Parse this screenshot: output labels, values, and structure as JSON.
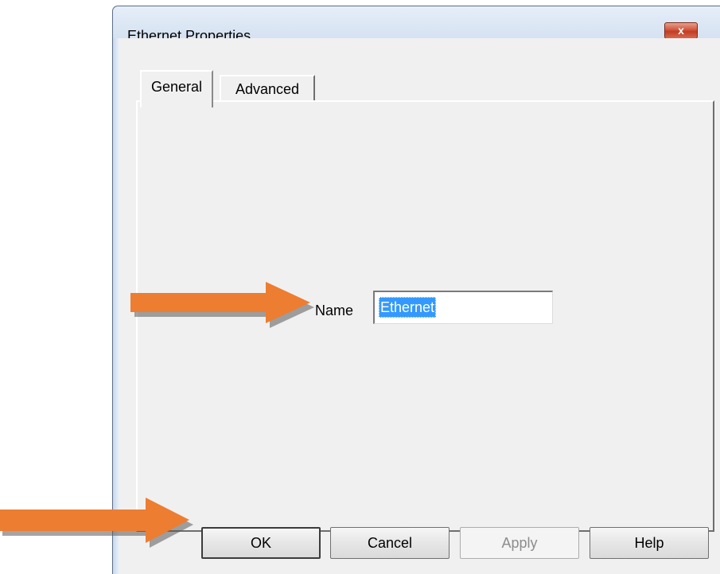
{
  "dialog": {
    "title": "Ethernet Properties",
    "close_symbol": "x"
  },
  "tabs": [
    {
      "label": "General",
      "selected": true
    },
    {
      "label": "Advanced",
      "selected": false
    }
  ],
  "general": {
    "name_label": "Name",
    "name_value": "Ethernet"
  },
  "buttons": {
    "ok": "OK",
    "cancel": "Cancel",
    "apply": "Apply",
    "help": "Help"
  },
  "icons": {
    "close": "close-icon",
    "arrow": "arrow-right-icon"
  },
  "colors": {
    "arrow": "#ed7d31",
    "selection": "#3399ff",
    "close_button": "#c84a30"
  }
}
